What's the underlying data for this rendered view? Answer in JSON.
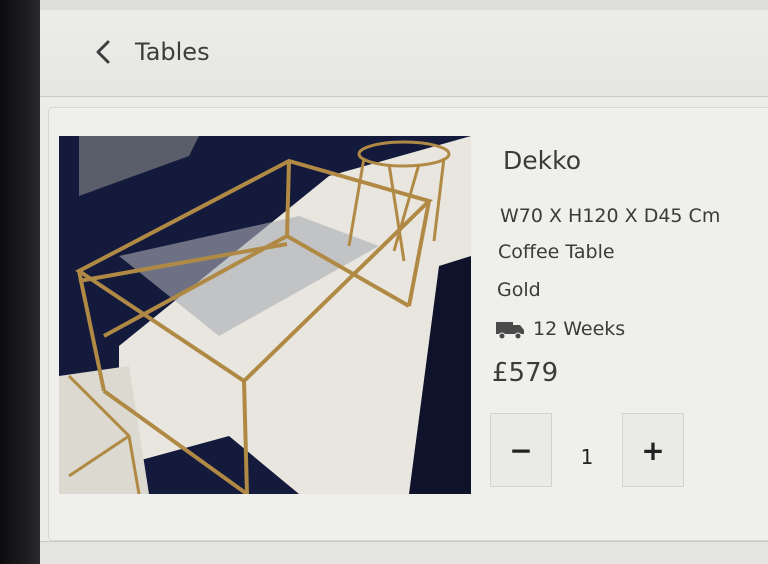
{
  "header": {
    "title": "Tables"
  },
  "product": {
    "name": "Dekko",
    "dimensions": "W70 X H120 X D45 Cm",
    "type": "Coffee Table",
    "color": "Gold",
    "delivery": "12 Weeks",
    "price": "£579"
  },
  "stepper": {
    "minus_label": "−",
    "quantity": "1",
    "plus_label": "+"
  },
  "icons": {
    "back": "chevron-left-icon",
    "delivery": "truck-icon"
  },
  "colors": {
    "background": "#ecece9",
    "text": "#3b3b3b",
    "frame_gold": "#b08a45"
  }
}
